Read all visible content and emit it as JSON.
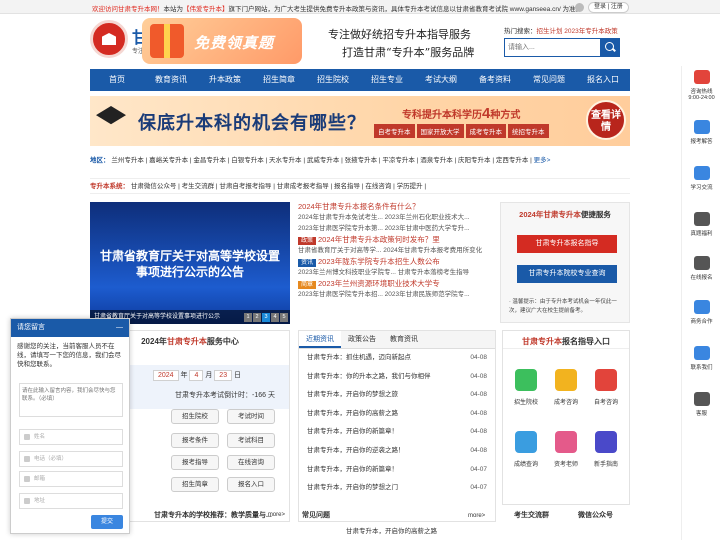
{
  "topbar": {
    "welcome_red": "欢迎访问甘肃专升本网！",
    "welcome_mid": "本站为",
    "welcome_brand": "【伟爱专升本】",
    "welcome_rest": "旗下门户网站，为广大考生提供免费专升本政策与资讯，具体专升本考试信息以甘肃省教育考试院 www.ganseea.cn/ 为准。",
    "login": "登录 | 注册"
  },
  "header": {
    "logo_text": "甘",
    "logo_sub": "专注",
    "promo_text": "免费领真题",
    "slogan1": "专注做好统招专升本指导服务",
    "slogan2": "打造甘肃“专升本”服务品牌",
    "hot_label": "热门搜索：",
    "hot_links": "招生计划  2023年专升本政策",
    "search_placeholder": "请输入..."
  },
  "nav": [
    "首页",
    "教育资讯",
    "升本政策",
    "招生简章",
    "招生院校",
    "招生专业",
    "考试大纲",
    "备考资料",
    "常见问题",
    "报名入口"
  ],
  "banner": {
    "main": "保底升本科的机会有哪些？",
    "subline_a": "专科提升本科学历",
    "subline_num": "4",
    "subline_b": "种方式",
    "tags": [
      "自考专升本",
      "国家开放大学",
      "成考专升本",
      "统招专升本"
    ],
    "detail": "查看详情"
  },
  "region": {
    "label": "地区：",
    "items": "兰州专升本 | 嘉峪关专升本 | 金昌专升本 | 白银专升本 | 天水专升本 | 武威专升本 | 张掖专升本 | 平凉专升本 | 酒泉专升本 | 庆阳专升本 | 定西专升本 |",
    "more": "更多>"
  },
  "sysline": {
    "label": "专升本系统：",
    "items": "甘肃微信公众号 | 考生交流群 | 甘肃自考报考指导 | 甘肃成考报考指导 | 报名指导 | 在线咨询 | 学历提升 |"
  },
  "slide": {
    "title": "甘肃省教育厅关于对高等学校设置事项进行公示的公告",
    "caption": "甘肃省教育厅关于对高等学校设置事项进行公示",
    "pages": [
      "1",
      "2",
      "3",
      "4",
      "5"
    ]
  },
  "news": {
    "head1": "2024年甘肃专升本报名条件有什么？",
    "sub1": "2024年甘肃专升本免试考生...  2023年兰州石化职业技术大...",
    "sub2": "2023年甘肃医学院专升本第...  2023年甘肃中医药大学专升...",
    "tag1": "政策",
    "head2": "2024年甘肃专升本政策何时发布？里",
    "sub3": "甘肃省教育厅关于对高等学...  2024年甘肃专升本报考费用所变化",
    "tag2": "资讯",
    "head3": "2023年陇东学院专升本招生人数公布",
    "sub4": "2023年兰州博文科技职业学院专...  甘肃专升本落榜考生指导",
    "tag3": "简章",
    "head4": "2023年兰州资源环境职业技术大学专",
    "sub5": "2023年甘肃医学院专升本招...  2023年甘肃民族师范学院专..."
  },
  "guide": {
    "title_red": "2024年甘肃专升本",
    "title_rest": "便捷服务",
    "btn1": "甘肃专升本报名指导",
    "btn2": "甘肃专升本院校专业查询",
    "tip": "· 温馨提示：由于专升本考试机会一年仅此一次，建议广大在校生提前备考。"
  },
  "svc": {
    "title_a": "2024年",
    "title_red": "甘肃专升本",
    "title_b": "服务中心",
    "year": "2024",
    "year_unit": "年",
    "month": "4",
    "month_unit": "月",
    "day": "23",
    "day_unit": "日",
    "countdown": "甘肃专升本考试倒计时：-166 天",
    "buttons": [
      "",
      "招生院校",
      "考试时间",
      "",
      "报考条件",
      "考试科目",
      "",
      "报考指导",
      "在线咨询",
      "",
      "招生简章",
      "报名入口"
    ],
    "more": "more>"
  },
  "tabs": {
    "labels": [
      "近期资讯",
      "政策公告",
      "教育资讯"
    ],
    "rows": [
      {
        "t": "甘肃专升本：抓住机遇，迈向新起点",
        "d": "04-08"
      },
      {
        "t": "甘肃专升本：你的升本之路，我们与你相伴",
        "d": "04-08"
      },
      {
        "t": "甘肃专升本，开启你的梦想之旅",
        "d": "04-08"
      },
      {
        "t": "甘肃专升本，开启你的高薪之路",
        "d": "04-08"
      },
      {
        "t": "甘肃专升本，开启你的新篇章！",
        "d": "04-08"
      },
      {
        "t": "甘肃专升本，开启你的逆袭之路！",
        "d": "04-08"
      },
      {
        "t": "甘肃专升本，开启你的新篇章！",
        "d": "04-07"
      },
      {
        "t": "甘肃专升本，开启你的梦想之门",
        "d": "04-07"
      }
    ],
    "more": "more>"
  },
  "apply": {
    "title_red": "甘肃专升本",
    "title_rest": "报名指导入口",
    "cells": [
      "招生院校",
      "成考咨询",
      "自考咨询",
      "成绩查询",
      "资考老师",
      "新手指南"
    ]
  },
  "bottom": {
    "left": "甘肃专升本的学校推荐：教学质量与...",
    "mid": "常见问题",
    "mid_item": "甘肃专升本，开启你的高薪之路",
    "r1": "考生交流群",
    "r2": "微信公众号",
    "more": "more>"
  },
  "chat": {
    "title": "请您留言",
    "close": "—",
    "intro": "感谢您的关注，当前客服人员不在线，请填写一下您的信息，我们会尽快和您联系。",
    "textarea": "请在此输入留言内容，我们会尽快与您联系。（必填）",
    "fields": [
      "姓名",
      "电话（必填）",
      "邮箱",
      "地址"
    ],
    "send": "提交"
  },
  "side": {
    "items": [
      "咨询热线\n9:00-24:00",
      "报考解答",
      "学习交流",
      "真题福利",
      "在线报名",
      "商务合作",
      "联系我们",
      "客服"
    ]
  },
  "colors": {
    "brand": "#1a5aa8",
    "accent": "#c0392b"
  }
}
